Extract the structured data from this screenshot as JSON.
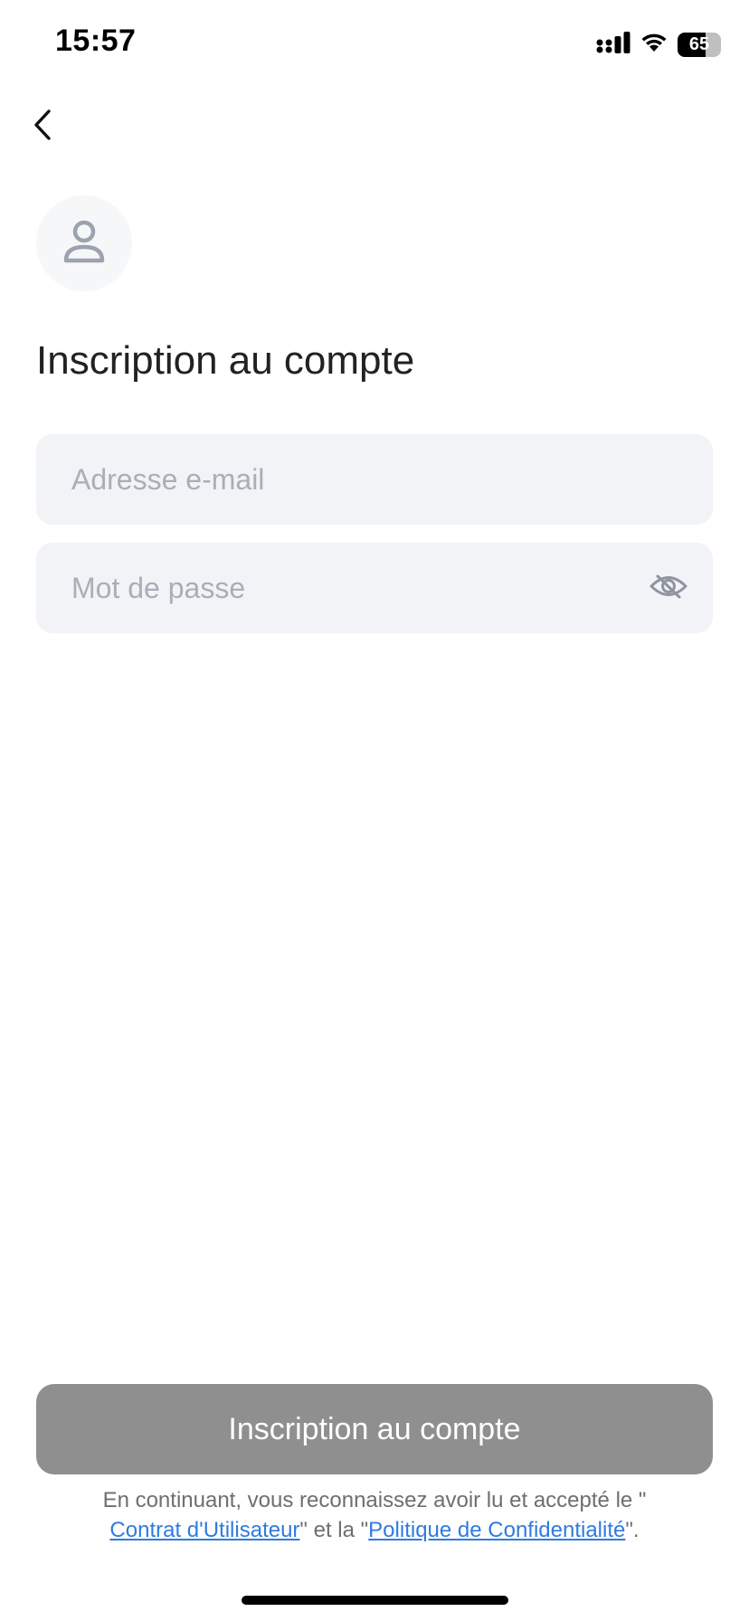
{
  "status_bar": {
    "time": "15:57",
    "battery_level": "65",
    "battery_fraction": 0.65,
    "icons": [
      "cellular-signal-icon",
      "wifi-icon",
      "battery-icon"
    ]
  },
  "nav": {
    "back_icon": "chevron-left-icon"
  },
  "avatar": {
    "icon": "user-icon"
  },
  "title": "Inscription au compte",
  "form": {
    "email_placeholder": "Adresse e-mail",
    "email_value": "",
    "password_placeholder": "Mot de passe",
    "password_value": "",
    "password_toggle_icon": "eye-off-icon"
  },
  "submit": {
    "label": "Inscription au compte",
    "enabled": false
  },
  "terms": {
    "prefix": "En continuant, vous reconnaissez avoir lu et accepté le \"",
    "user_agreement": "Contrat d'Utilisateur",
    "middle": "\" et la \"",
    "privacy_policy": "Politique de Confidentialité",
    "suffix": "\"."
  },
  "colors": {
    "accent_link": "#2f7be0",
    "disabled_button": "#8f8f8f",
    "field_background": "#f2f3f6",
    "placeholder": "#a9aeb8"
  }
}
